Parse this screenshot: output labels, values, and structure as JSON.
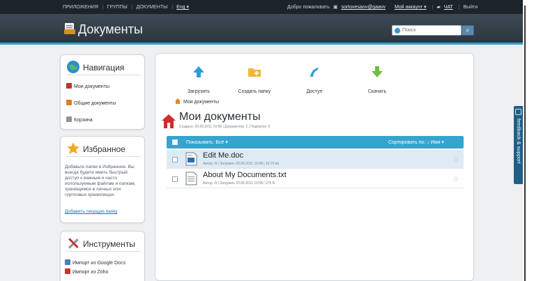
{
  "topbar": {
    "links": [
      "ПРИЛОЖЕНИЯ",
      "ГРУППЫ",
      "ДОКУМЕНТЫ"
    ],
    "lang": "Eng ▾",
    "welcome": "Добро пожаловать",
    "username": "sortovesaov@gaavv",
    "my_account": "Мой аккаунт ▾",
    "chat": "ЧАТ",
    "logout": "Выйти"
  },
  "header": {
    "title": "Документы",
    "search_placeholder": "Поиск",
    "search_button": "⌕"
  },
  "navigation": {
    "title": "Навигация",
    "items": [
      "Мои документы",
      "Общие документы",
      "Корзина"
    ]
  },
  "favorites": {
    "title": "Избранное",
    "text": "Добавьте папки в Избранное. Вы всегда будете иметь быстрый доступ к важным и часто используемым файлам и папкам, хранящимся в личных или групповых хранилищах.",
    "add_link": "Добавить текущую папку"
  },
  "tools": {
    "title": "Инструменты",
    "items": [
      "Импорт из Google Docs",
      "Импорт из Zoho"
    ]
  },
  "actions": [
    "Загрузить",
    "Создать папку",
    "Доступ",
    "Скачать"
  ],
  "breadcrumb": "Мои документы",
  "page": {
    "title": "Мои документы",
    "meta": "Создано: 20.06.2011 10:08 | Документов: 2 | Подпапок: 0"
  },
  "list_header": {
    "left": "Показывать: Всё ▾",
    "right": "Сортировать по: ↓ Имя ▾"
  },
  "files": [
    {
      "name": "Edit Me.doc",
      "meta": "Автор: Я | Загружен 20.06.2011 10:08 | 10.75 kb"
    },
    {
      "name": "About My Documents.txt",
      "meta": "Автор: Я | Загружен 20.06.2011 10:08 | 275 B"
    }
  ],
  "feedback": "feedback & support",
  "colors": {
    "accent": "#35a4cf",
    "title_bar": "#2c363e",
    "feedback": "#1f5f86"
  },
  "icons": {
    "upload": "arrow-up-icon",
    "new_folder": "folder-plus-icon",
    "share": "share-icon",
    "download": "arrow-down-icon"
  }
}
